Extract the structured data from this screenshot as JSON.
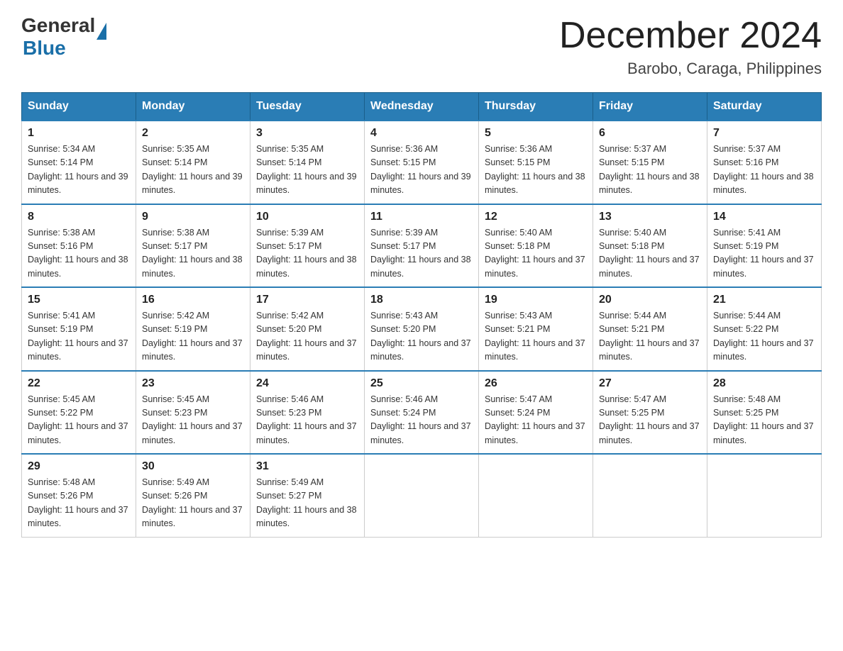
{
  "logo": {
    "general": "General",
    "blue": "Blue"
  },
  "title": "December 2024",
  "location": "Barobo, Caraga, Philippines",
  "days_of_week": [
    "Sunday",
    "Monday",
    "Tuesday",
    "Wednesday",
    "Thursday",
    "Friday",
    "Saturday"
  ],
  "weeks": [
    [
      {
        "day": "1",
        "sunrise": "5:34 AM",
        "sunset": "5:14 PM",
        "daylight": "11 hours and 39 minutes."
      },
      {
        "day": "2",
        "sunrise": "5:35 AM",
        "sunset": "5:14 PM",
        "daylight": "11 hours and 39 minutes."
      },
      {
        "day": "3",
        "sunrise": "5:35 AM",
        "sunset": "5:14 PM",
        "daylight": "11 hours and 39 minutes."
      },
      {
        "day": "4",
        "sunrise": "5:36 AM",
        "sunset": "5:15 PM",
        "daylight": "11 hours and 39 minutes."
      },
      {
        "day": "5",
        "sunrise": "5:36 AM",
        "sunset": "5:15 PM",
        "daylight": "11 hours and 38 minutes."
      },
      {
        "day": "6",
        "sunrise": "5:37 AM",
        "sunset": "5:15 PM",
        "daylight": "11 hours and 38 minutes."
      },
      {
        "day": "7",
        "sunrise": "5:37 AM",
        "sunset": "5:16 PM",
        "daylight": "11 hours and 38 minutes."
      }
    ],
    [
      {
        "day": "8",
        "sunrise": "5:38 AM",
        "sunset": "5:16 PM",
        "daylight": "11 hours and 38 minutes."
      },
      {
        "day": "9",
        "sunrise": "5:38 AM",
        "sunset": "5:17 PM",
        "daylight": "11 hours and 38 minutes."
      },
      {
        "day": "10",
        "sunrise": "5:39 AM",
        "sunset": "5:17 PM",
        "daylight": "11 hours and 38 minutes."
      },
      {
        "day": "11",
        "sunrise": "5:39 AM",
        "sunset": "5:17 PM",
        "daylight": "11 hours and 38 minutes."
      },
      {
        "day": "12",
        "sunrise": "5:40 AM",
        "sunset": "5:18 PM",
        "daylight": "11 hours and 37 minutes."
      },
      {
        "day": "13",
        "sunrise": "5:40 AM",
        "sunset": "5:18 PM",
        "daylight": "11 hours and 37 minutes."
      },
      {
        "day": "14",
        "sunrise": "5:41 AM",
        "sunset": "5:19 PM",
        "daylight": "11 hours and 37 minutes."
      }
    ],
    [
      {
        "day": "15",
        "sunrise": "5:41 AM",
        "sunset": "5:19 PM",
        "daylight": "11 hours and 37 minutes."
      },
      {
        "day": "16",
        "sunrise": "5:42 AM",
        "sunset": "5:19 PM",
        "daylight": "11 hours and 37 minutes."
      },
      {
        "day": "17",
        "sunrise": "5:42 AM",
        "sunset": "5:20 PM",
        "daylight": "11 hours and 37 minutes."
      },
      {
        "day": "18",
        "sunrise": "5:43 AM",
        "sunset": "5:20 PM",
        "daylight": "11 hours and 37 minutes."
      },
      {
        "day": "19",
        "sunrise": "5:43 AM",
        "sunset": "5:21 PM",
        "daylight": "11 hours and 37 minutes."
      },
      {
        "day": "20",
        "sunrise": "5:44 AM",
        "sunset": "5:21 PM",
        "daylight": "11 hours and 37 minutes."
      },
      {
        "day": "21",
        "sunrise": "5:44 AM",
        "sunset": "5:22 PM",
        "daylight": "11 hours and 37 minutes."
      }
    ],
    [
      {
        "day": "22",
        "sunrise": "5:45 AM",
        "sunset": "5:22 PM",
        "daylight": "11 hours and 37 minutes."
      },
      {
        "day": "23",
        "sunrise": "5:45 AM",
        "sunset": "5:23 PM",
        "daylight": "11 hours and 37 minutes."
      },
      {
        "day": "24",
        "sunrise": "5:46 AM",
        "sunset": "5:23 PM",
        "daylight": "11 hours and 37 minutes."
      },
      {
        "day": "25",
        "sunrise": "5:46 AM",
        "sunset": "5:24 PM",
        "daylight": "11 hours and 37 minutes."
      },
      {
        "day": "26",
        "sunrise": "5:47 AM",
        "sunset": "5:24 PM",
        "daylight": "11 hours and 37 minutes."
      },
      {
        "day": "27",
        "sunrise": "5:47 AM",
        "sunset": "5:25 PM",
        "daylight": "11 hours and 37 minutes."
      },
      {
        "day": "28",
        "sunrise": "5:48 AM",
        "sunset": "5:25 PM",
        "daylight": "11 hours and 37 minutes."
      }
    ],
    [
      {
        "day": "29",
        "sunrise": "5:48 AM",
        "sunset": "5:26 PM",
        "daylight": "11 hours and 37 minutes."
      },
      {
        "day": "30",
        "sunrise": "5:49 AM",
        "sunset": "5:26 PM",
        "daylight": "11 hours and 37 minutes."
      },
      {
        "day": "31",
        "sunrise": "5:49 AM",
        "sunset": "5:27 PM",
        "daylight": "11 hours and 38 minutes."
      },
      null,
      null,
      null,
      null
    ]
  ]
}
